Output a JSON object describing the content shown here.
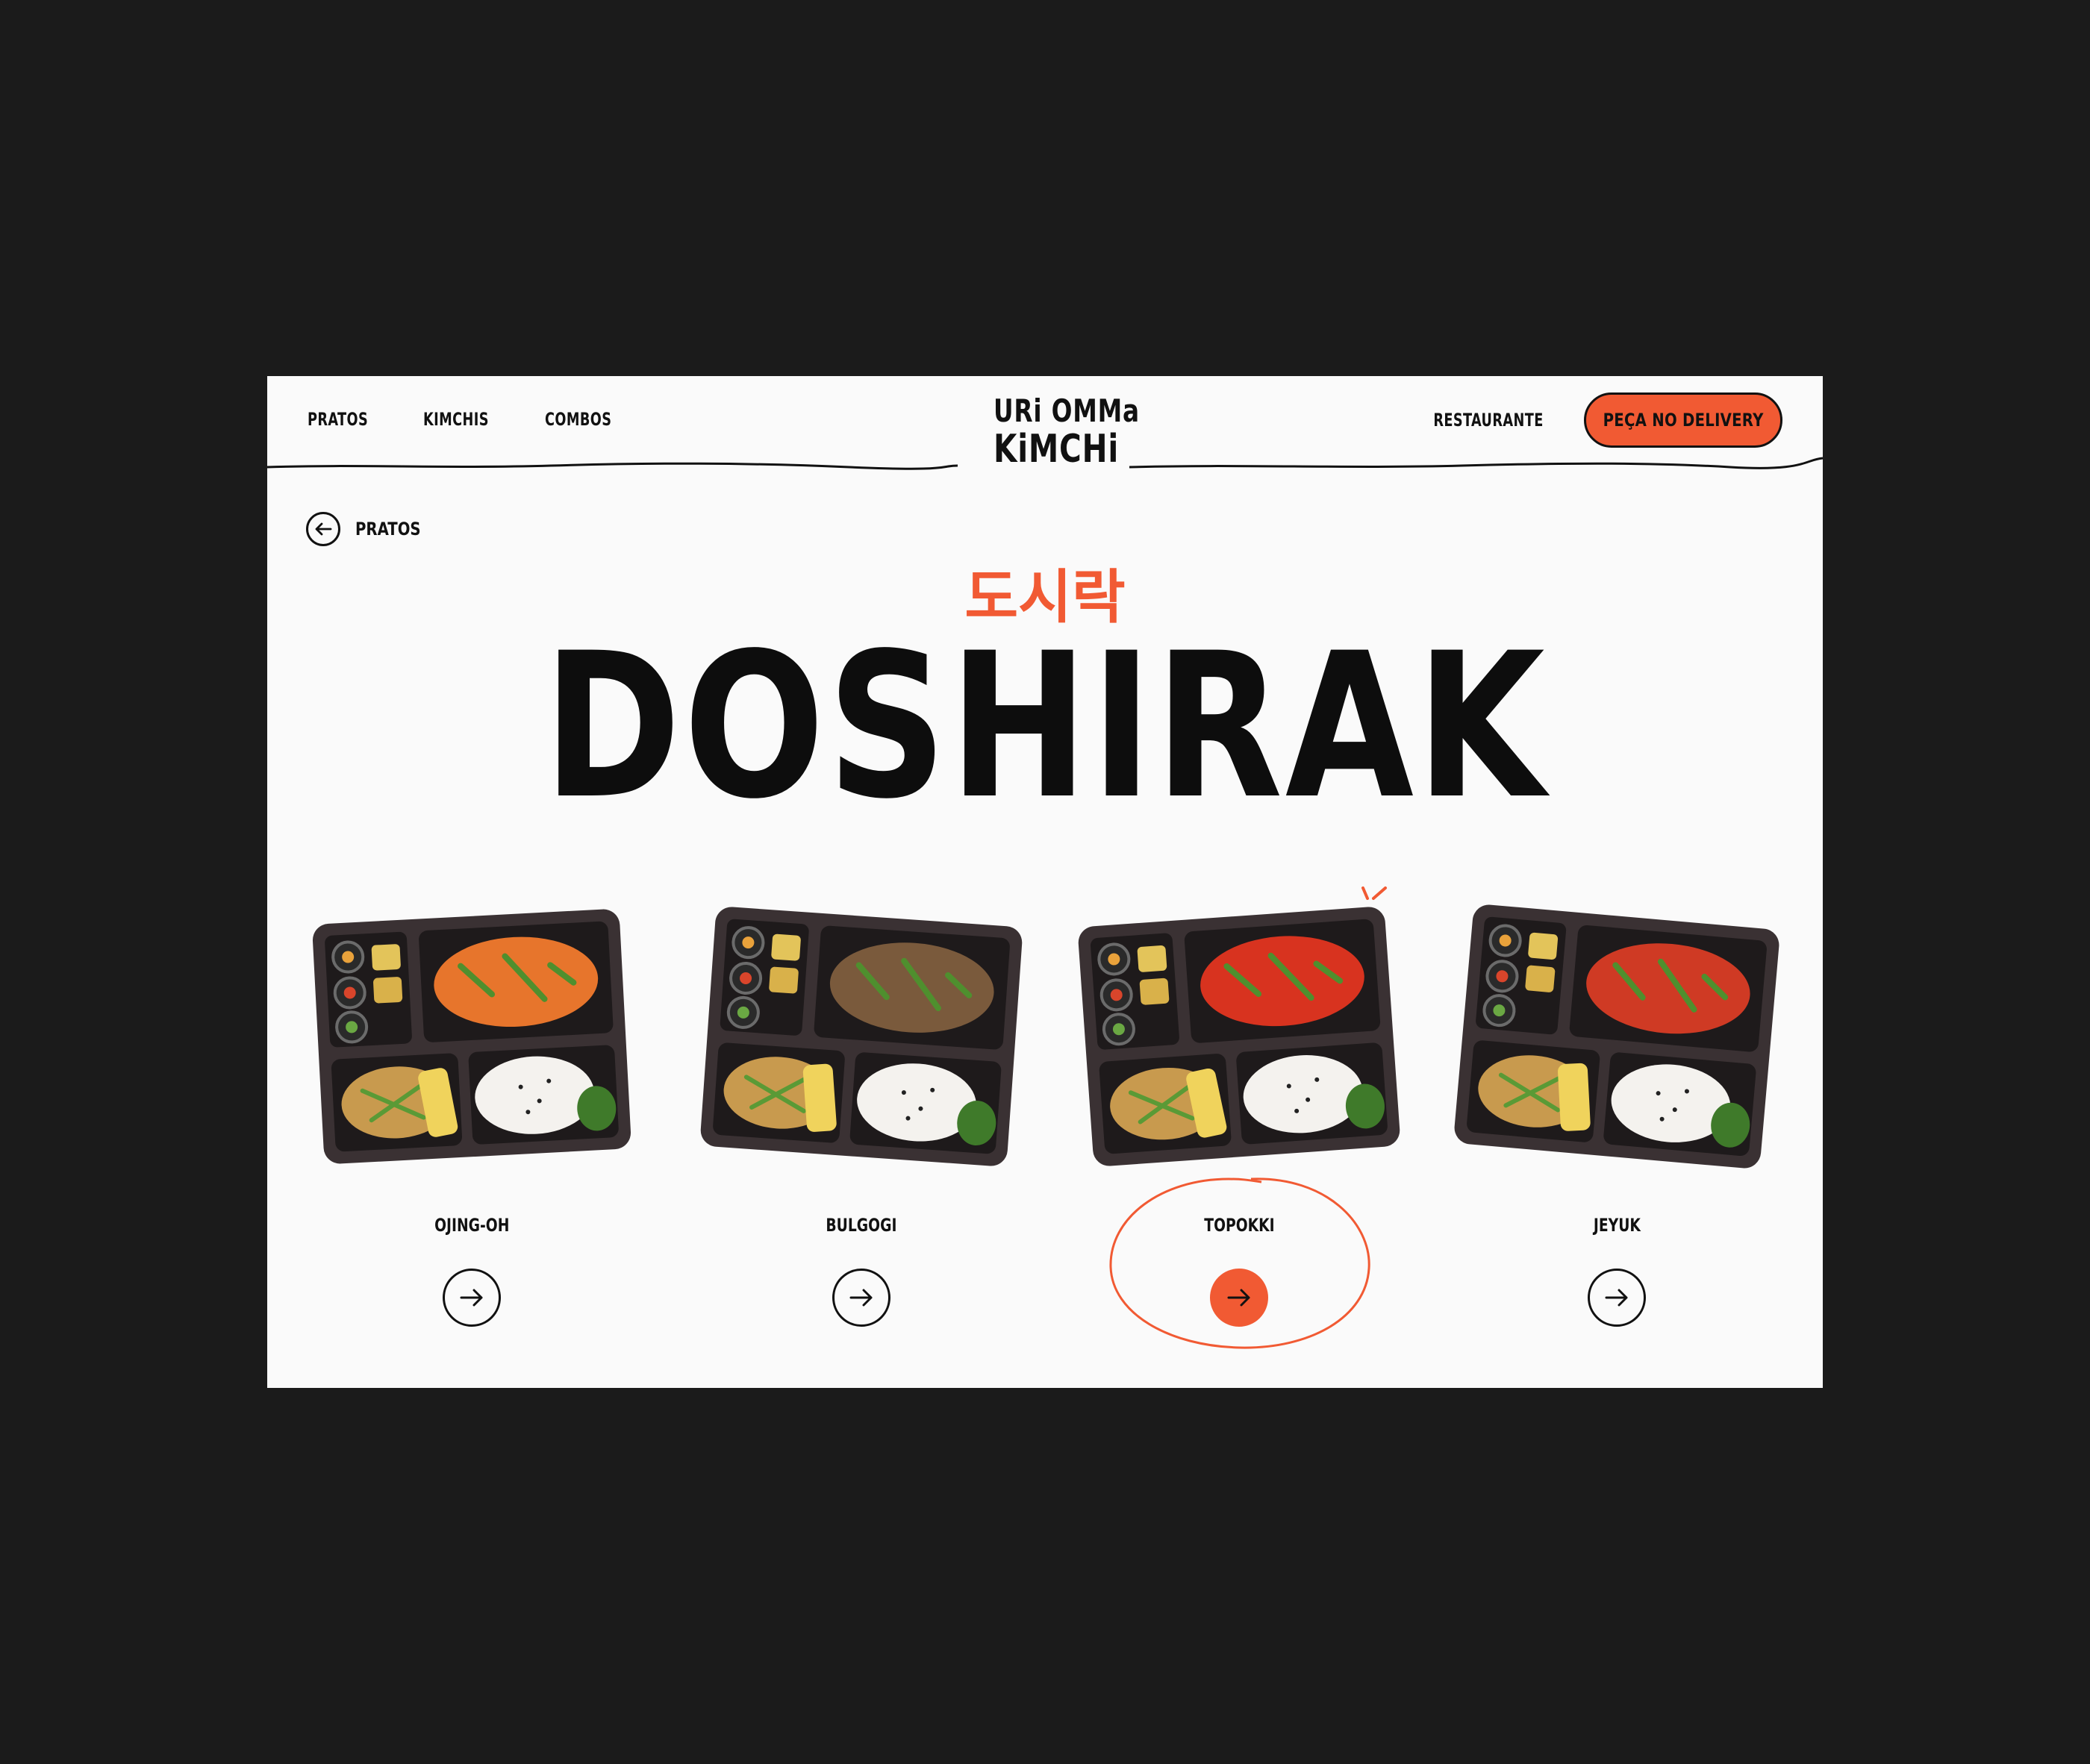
{
  "nav": {
    "left_links": [
      "PRATOS",
      "KIMCHIS",
      "COMBOS"
    ],
    "restaurant_link": "RESTAURANTE",
    "delivery_button": "PEÇA NO DELIVERY"
  },
  "logo": {
    "line1": "URi OMMa",
    "line2": "KiMCHi"
  },
  "back": {
    "label": "PRATOS",
    "icon": "arrow-left-icon"
  },
  "hero": {
    "korean_title": "도시락",
    "title": "DOSHIRAK"
  },
  "products": [
    {
      "name": "OJING-OH",
      "highlight": "#e7752c",
      "active": false
    },
    {
      "name": "BULGOGI",
      "highlight": "#7a5a3c",
      "active": false
    },
    {
      "name": "TOPOKKI",
      "highlight": "#d8331f",
      "active": true
    },
    {
      "name": "JEYUK",
      "highlight": "#cf3a24",
      "active": false
    }
  ],
  "colors": {
    "accent": "#f15a33",
    "background_outer": "#1b1b1b",
    "page_background": "#fafafa",
    "text": "#111111",
    "tray": "#3a3133"
  }
}
